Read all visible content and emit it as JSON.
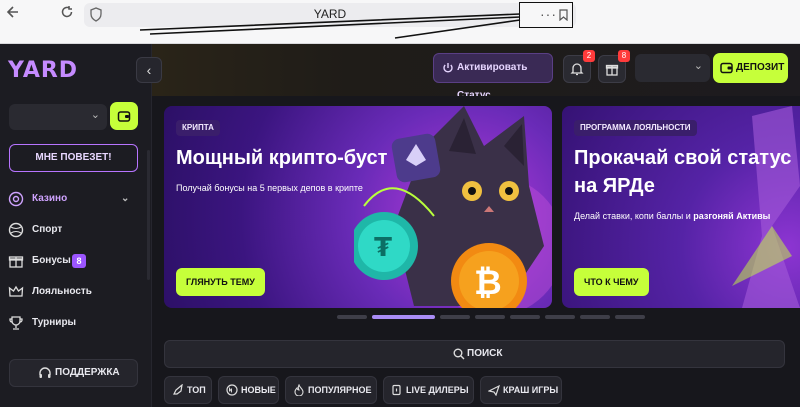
{
  "browser": {
    "url": "YARD",
    "back_icon": "arrow-left-icon",
    "reload_icon": "reload-icon",
    "menu_dots": "···"
  },
  "brand": {
    "logo_text": "YARD",
    "accent": "#c58bff",
    "lime": "#c6ff3a"
  },
  "sidebar": {
    "collapse_icon": "‹",
    "lucky_label": "МНЕ ПОВЕЗЕТ!",
    "items": [
      {
        "label": "Казино",
        "icon": "casino-chip-icon",
        "active": true
      },
      {
        "label": "Спорт",
        "icon": "ball-icon"
      },
      {
        "label": "Бонусы",
        "icon": "gift-icon",
        "badge": "8"
      },
      {
        "label": "Лояльность",
        "icon": "crown-icon"
      },
      {
        "label": "Турниры",
        "icon": "trophy-icon"
      }
    ],
    "support_label": "ПОДДЕРЖКА"
  },
  "header": {
    "activate_label": "Активировать Статус",
    "notifications_count": "2",
    "gifts_count": "8",
    "deposit_label": "ДЕПОЗИТ"
  },
  "banners": [
    {
      "tag": "КРИПТА",
      "title": "Мощный крипто-буст",
      "subtitle": "Получай бонусы на 5 первых депов в крипте",
      "button": "ГЛЯНУТЬ ТЕМУ"
    },
    {
      "tag": "ПРОГРАММА ЛОЯЛЬНОСТИ",
      "title_line1": "Прокачай свой статус",
      "title_line2": "на ЯРДе",
      "subtitle_plain": "Делай ставки, копи баллы и ",
      "subtitle_bold": "разгоняй Активы",
      "button": "ЧТО К ЧЕМУ"
    }
  ],
  "carousel": {
    "count": 8,
    "active_index": 1
  },
  "search": {
    "label": "ПОИСК"
  },
  "categories": [
    {
      "label": "ТОП",
      "icon": "rocket-icon"
    },
    {
      "label": "НОВЫЕ",
      "icon": "new-icon"
    },
    {
      "label": "ПОПУЛЯРНОЕ",
      "icon": "fire-icon"
    },
    {
      "label": "LIVE ДИЛЕРЫ",
      "icon": "cards-icon"
    },
    {
      "label": "КРАШ ИГРЫ",
      "icon": "plane-icon"
    }
  ]
}
